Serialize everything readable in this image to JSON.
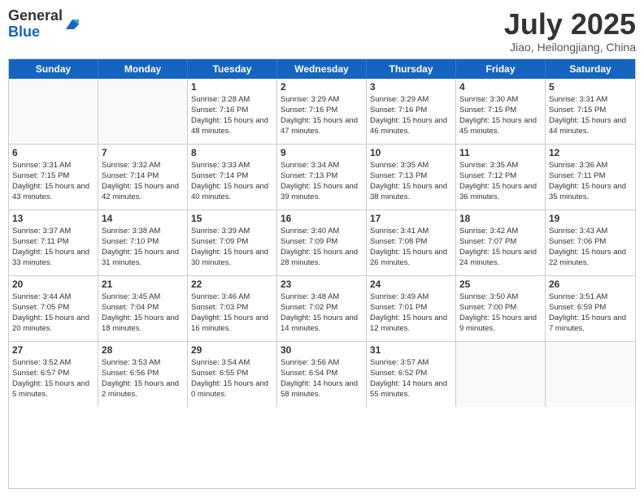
{
  "logo": {
    "general": "General",
    "blue": "Blue"
  },
  "title": "July 2025",
  "subtitle": "Jiao, Heilongjiang, China",
  "days_of_week": [
    "Sunday",
    "Monday",
    "Tuesday",
    "Wednesday",
    "Thursday",
    "Friday",
    "Saturday"
  ],
  "weeks": [
    [
      {
        "day": "",
        "info": ""
      },
      {
        "day": "",
        "info": ""
      },
      {
        "day": "1",
        "info": "Sunrise: 3:28 AM\nSunset: 7:16 PM\nDaylight: 15 hours and 48 minutes."
      },
      {
        "day": "2",
        "info": "Sunrise: 3:29 AM\nSunset: 7:16 PM\nDaylight: 15 hours and 47 minutes."
      },
      {
        "day": "3",
        "info": "Sunrise: 3:29 AM\nSunset: 7:16 PM\nDaylight: 15 hours and 46 minutes."
      },
      {
        "day": "4",
        "info": "Sunrise: 3:30 AM\nSunset: 7:15 PM\nDaylight: 15 hours and 45 minutes."
      },
      {
        "day": "5",
        "info": "Sunrise: 3:31 AM\nSunset: 7:15 PM\nDaylight: 15 hours and 44 minutes."
      }
    ],
    [
      {
        "day": "6",
        "info": "Sunrise: 3:31 AM\nSunset: 7:15 PM\nDaylight: 15 hours and 43 minutes."
      },
      {
        "day": "7",
        "info": "Sunrise: 3:32 AM\nSunset: 7:14 PM\nDaylight: 15 hours and 42 minutes."
      },
      {
        "day": "8",
        "info": "Sunrise: 3:33 AM\nSunset: 7:14 PM\nDaylight: 15 hours and 40 minutes."
      },
      {
        "day": "9",
        "info": "Sunrise: 3:34 AM\nSunset: 7:13 PM\nDaylight: 15 hours and 39 minutes."
      },
      {
        "day": "10",
        "info": "Sunrise: 3:35 AM\nSunset: 7:13 PM\nDaylight: 15 hours and 38 minutes."
      },
      {
        "day": "11",
        "info": "Sunrise: 3:35 AM\nSunset: 7:12 PM\nDaylight: 15 hours and 36 minutes."
      },
      {
        "day": "12",
        "info": "Sunrise: 3:36 AM\nSunset: 7:11 PM\nDaylight: 15 hours and 35 minutes."
      }
    ],
    [
      {
        "day": "13",
        "info": "Sunrise: 3:37 AM\nSunset: 7:11 PM\nDaylight: 15 hours and 33 minutes."
      },
      {
        "day": "14",
        "info": "Sunrise: 3:38 AM\nSunset: 7:10 PM\nDaylight: 15 hours and 31 minutes."
      },
      {
        "day": "15",
        "info": "Sunrise: 3:39 AM\nSunset: 7:09 PM\nDaylight: 15 hours and 30 minutes."
      },
      {
        "day": "16",
        "info": "Sunrise: 3:40 AM\nSunset: 7:09 PM\nDaylight: 15 hours and 28 minutes."
      },
      {
        "day": "17",
        "info": "Sunrise: 3:41 AM\nSunset: 7:08 PM\nDaylight: 15 hours and 26 minutes."
      },
      {
        "day": "18",
        "info": "Sunrise: 3:42 AM\nSunset: 7:07 PM\nDaylight: 15 hours and 24 minutes."
      },
      {
        "day": "19",
        "info": "Sunrise: 3:43 AM\nSunset: 7:06 PM\nDaylight: 15 hours and 22 minutes."
      }
    ],
    [
      {
        "day": "20",
        "info": "Sunrise: 3:44 AM\nSunset: 7:05 PM\nDaylight: 15 hours and 20 minutes."
      },
      {
        "day": "21",
        "info": "Sunrise: 3:45 AM\nSunset: 7:04 PM\nDaylight: 15 hours and 18 minutes."
      },
      {
        "day": "22",
        "info": "Sunrise: 3:46 AM\nSunset: 7:03 PM\nDaylight: 15 hours and 16 minutes."
      },
      {
        "day": "23",
        "info": "Sunrise: 3:48 AM\nSunset: 7:02 PM\nDaylight: 15 hours and 14 minutes."
      },
      {
        "day": "24",
        "info": "Sunrise: 3:49 AM\nSunset: 7:01 PM\nDaylight: 15 hours and 12 minutes."
      },
      {
        "day": "25",
        "info": "Sunrise: 3:50 AM\nSunset: 7:00 PM\nDaylight: 15 hours and 9 minutes."
      },
      {
        "day": "26",
        "info": "Sunrise: 3:51 AM\nSunset: 6:59 PM\nDaylight: 15 hours and 7 minutes."
      }
    ],
    [
      {
        "day": "27",
        "info": "Sunrise: 3:52 AM\nSunset: 6:57 PM\nDaylight: 15 hours and 5 minutes."
      },
      {
        "day": "28",
        "info": "Sunrise: 3:53 AM\nSunset: 6:56 PM\nDaylight: 15 hours and 2 minutes."
      },
      {
        "day": "29",
        "info": "Sunrise: 3:54 AM\nSunset: 6:55 PM\nDaylight: 15 hours and 0 minutes."
      },
      {
        "day": "30",
        "info": "Sunrise: 3:56 AM\nSunset: 6:54 PM\nDaylight: 14 hours and 58 minutes."
      },
      {
        "day": "31",
        "info": "Sunrise: 3:57 AM\nSunset: 6:52 PM\nDaylight: 14 hours and 55 minutes."
      },
      {
        "day": "",
        "info": ""
      },
      {
        "day": "",
        "info": ""
      }
    ]
  ]
}
